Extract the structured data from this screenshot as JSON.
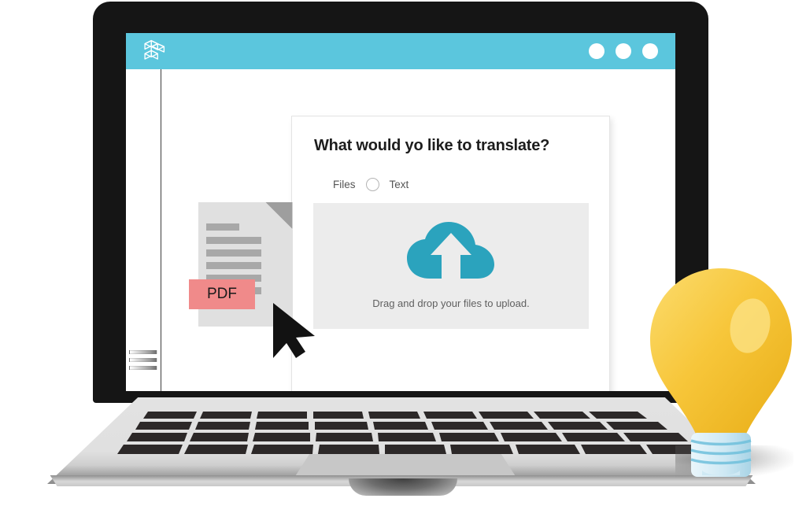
{
  "app": {
    "titlebar": {
      "logo_icon": "isometric-blocks-logo",
      "window_controls": [
        "dot-1",
        "dot-2",
        "dot-3"
      ],
      "bar_color": "#5bc6dd"
    },
    "sidebar": {
      "menu_icon": "stacked-lines-icon"
    }
  },
  "dialog": {
    "title": "What would yo like to translate?",
    "options": {
      "files_label": "Files",
      "toggle_icon": "radio-circle-unchecked",
      "text_label": "Text"
    },
    "dropzone": {
      "icon": "cloud-upload-icon",
      "icon_color": "#2ba3bd",
      "hint": "Drag and drop your files to upload.",
      "background": "#ececec"
    }
  },
  "document_asset": {
    "badge_label": "PDF",
    "badge_color": "#f08a8a",
    "page_color": "#e0e0e0",
    "cursor_icon": "arrow-cursor"
  },
  "bulb_asset": {
    "icon": "light-bulb-icon",
    "glass_color": "#f5c22b",
    "base_color": "#bfe2f0"
  },
  "hardware": {
    "laptop_icon": "laptop-illustration",
    "lid_color": "#151515",
    "base_color": "#e0e0e0",
    "trackpad_icon": "trackpad"
  }
}
